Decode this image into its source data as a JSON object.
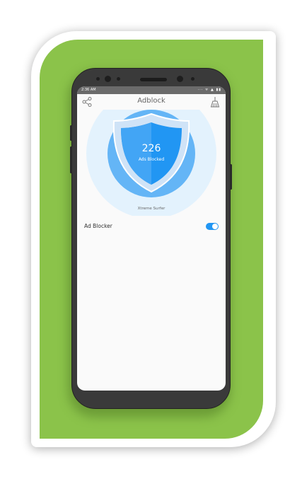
{
  "status_bar": {
    "time": "2:36 AM",
    "icons": "··· ᯤ ▲ ▮▮"
  },
  "app_bar": {
    "title": "Adblock",
    "left_icon": "share-icon",
    "right_icon": "sweep-icon"
  },
  "hero": {
    "count": "226",
    "count_label": "Ads Blocked",
    "brand": "Xtreme Surfer"
  },
  "settings": [
    {
      "label": "Ad Blocker",
      "enabled": true
    }
  ],
  "colors": {
    "background_green": "#8bc34a",
    "accent_blue": "#2196f3",
    "shield_light": "#64b5f6"
  }
}
